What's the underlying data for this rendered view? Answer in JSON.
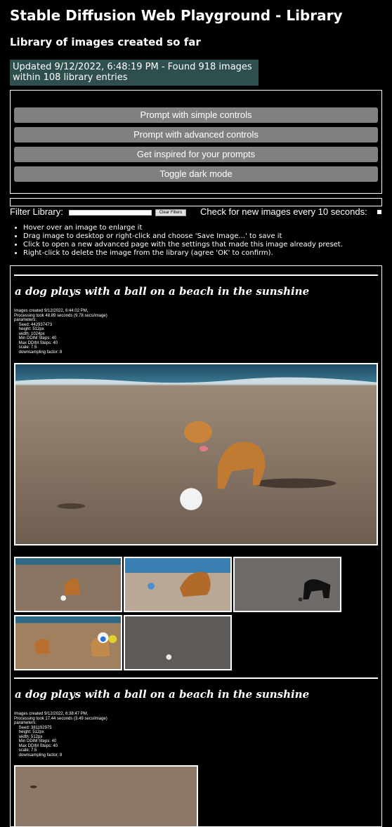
{
  "page": {
    "title": "Stable Diffusion Web Playground - Library",
    "subtitle": "Library of images created so far",
    "status": "Updated 9/12/2022, 6:48:19 PM - Found 918 images within 108 library entries"
  },
  "controls": {
    "buttons": [
      "Prompt with simple controls",
      "Prompt with advanced controls",
      "Get inspired for your prompts",
      "Toggle dark mode"
    ]
  },
  "filter": {
    "label": "Filter Library:",
    "value": "",
    "clear_label": "Clear Filters",
    "check_label": "Check for new images every 10 seconds:",
    "check_checked": true
  },
  "tips": [
    "Hover over an image to enlarge it",
    "Drag image to desktop or right-click and choose 'Save Image...' to save it",
    "Click to open a new advanced page with the settings that made this image already preset.",
    "Right-click to delete the image from the library (agree 'OK' to confirm)."
  ],
  "entries": [
    {
      "title": "a dog plays with a ball on a beach in the sunshine",
      "meta": [
        "Images created 9/12/2022, 6:44:02 PM,",
        "Processing took 48.89 seconds (9.78 secs/image)",
        "parameters:",
        "    Seed: 442937473",
        "    height: 512px",
        "    width: 1024px",
        "    Min DDIM Steps: 40",
        "    Max DDIM Steps: 40",
        "    scale: 7.5",
        "    downsampling factor: 8"
      ]
    },
    {
      "title": "a dog plays with a ball on a beach in the sunshine",
      "meta": [
        "Images created 9/12/2022, 6:38:47 PM,",
        "Processing took 17.44 seconds (3.49 secs/image)",
        "parameters:",
        "    Seed: 381192975",
        "    height: 512px",
        "    width: 512px",
        "    Min DDIM Steps: 40",
        "    Max DDIM Steps: 40",
        "    scale: 7.5",
        "    downsampling factor: 8"
      ]
    }
  ]
}
